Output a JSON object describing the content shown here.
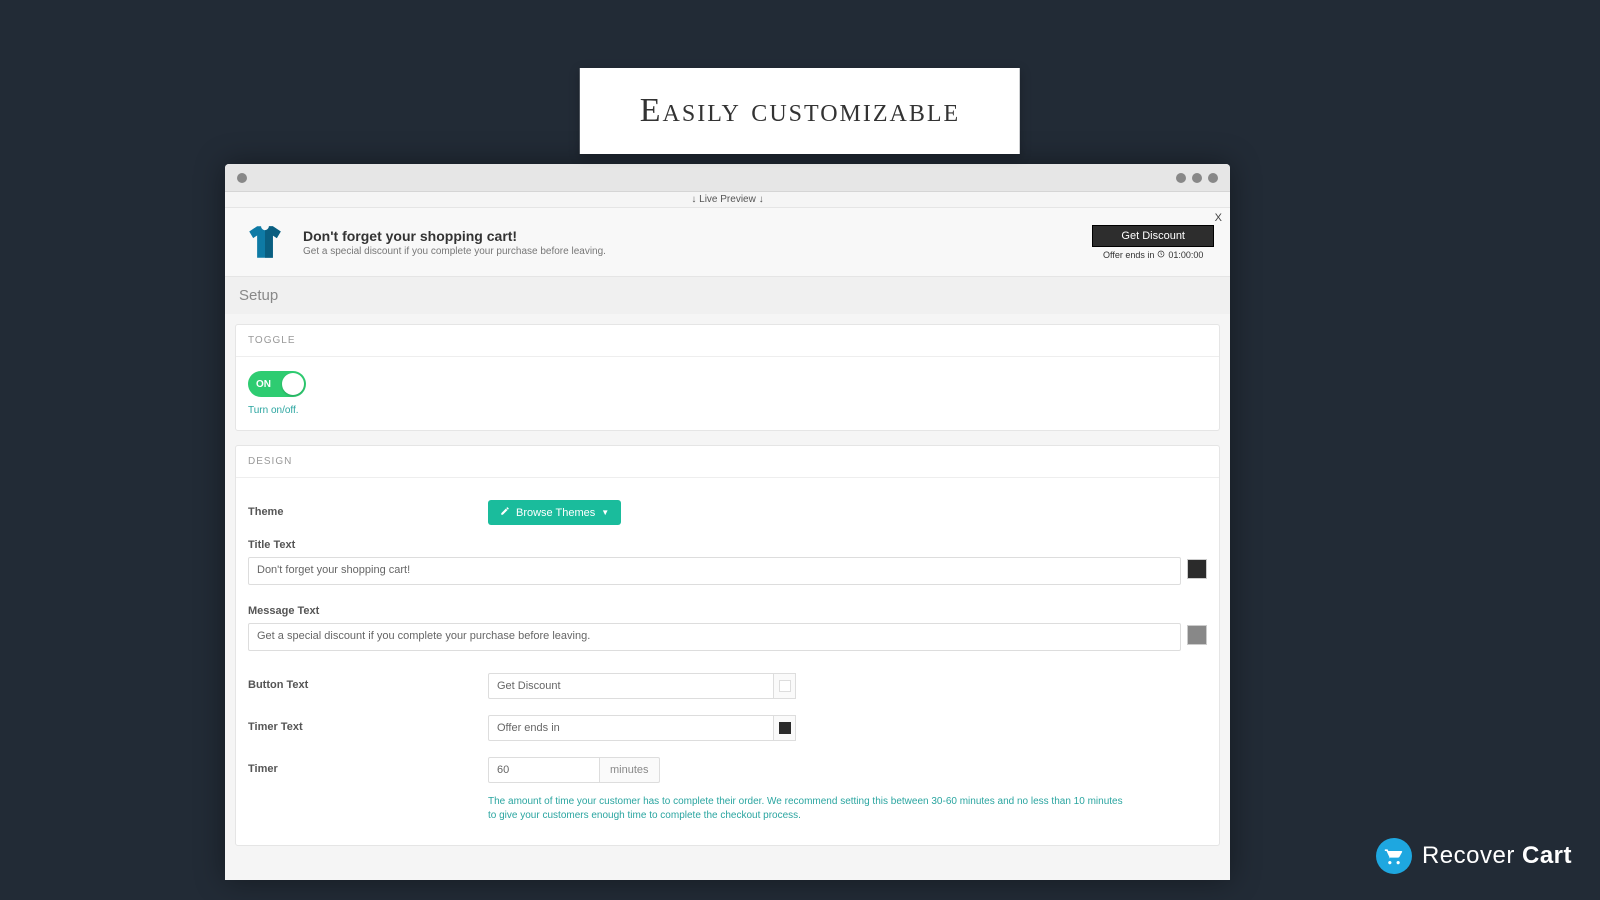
{
  "floating_title": "Easily customizable",
  "live_preview_label": "Live Preview",
  "notification": {
    "close_label": "X",
    "title": "Don't forget your shopping cart!",
    "subtitle": "Get a special discount if you complete your purchase before leaving.",
    "button_label": "Get Discount",
    "timer_prefix": "Offer ends in",
    "timer_value": "01:00:00"
  },
  "setup_title": "Setup",
  "toggle_section": {
    "header": "TOGGLE",
    "switch_label": "ON",
    "help": "Turn on/off."
  },
  "design_section": {
    "header": "DESIGN",
    "theme_label": "Theme",
    "browse_button": "Browse Themes",
    "title_text_label": "Title Text",
    "title_text_value": "Don't forget your shopping cart!",
    "title_color": "#2b2b2b",
    "message_text_label": "Message Text",
    "message_text_value": "Get a special discount if you complete your purchase before leaving.",
    "message_color": "#888888",
    "button_text_label": "Button Text",
    "button_text_value": "Get Discount",
    "button_color": "#ffffff",
    "timer_text_label": "Timer Text",
    "timer_text_value": "Offer ends in",
    "timer_text_color": "#2b2b2b",
    "timer_label": "Timer",
    "timer_value": "60",
    "timer_unit": "minutes",
    "timer_help": "The amount of time your customer has to complete their order. We recommend setting this between 30-60 minutes and no less than 10 minutes to give your customers enough time to complete the checkout process."
  },
  "brand": {
    "name_light": "Recover",
    "name_bold": "Cart"
  }
}
